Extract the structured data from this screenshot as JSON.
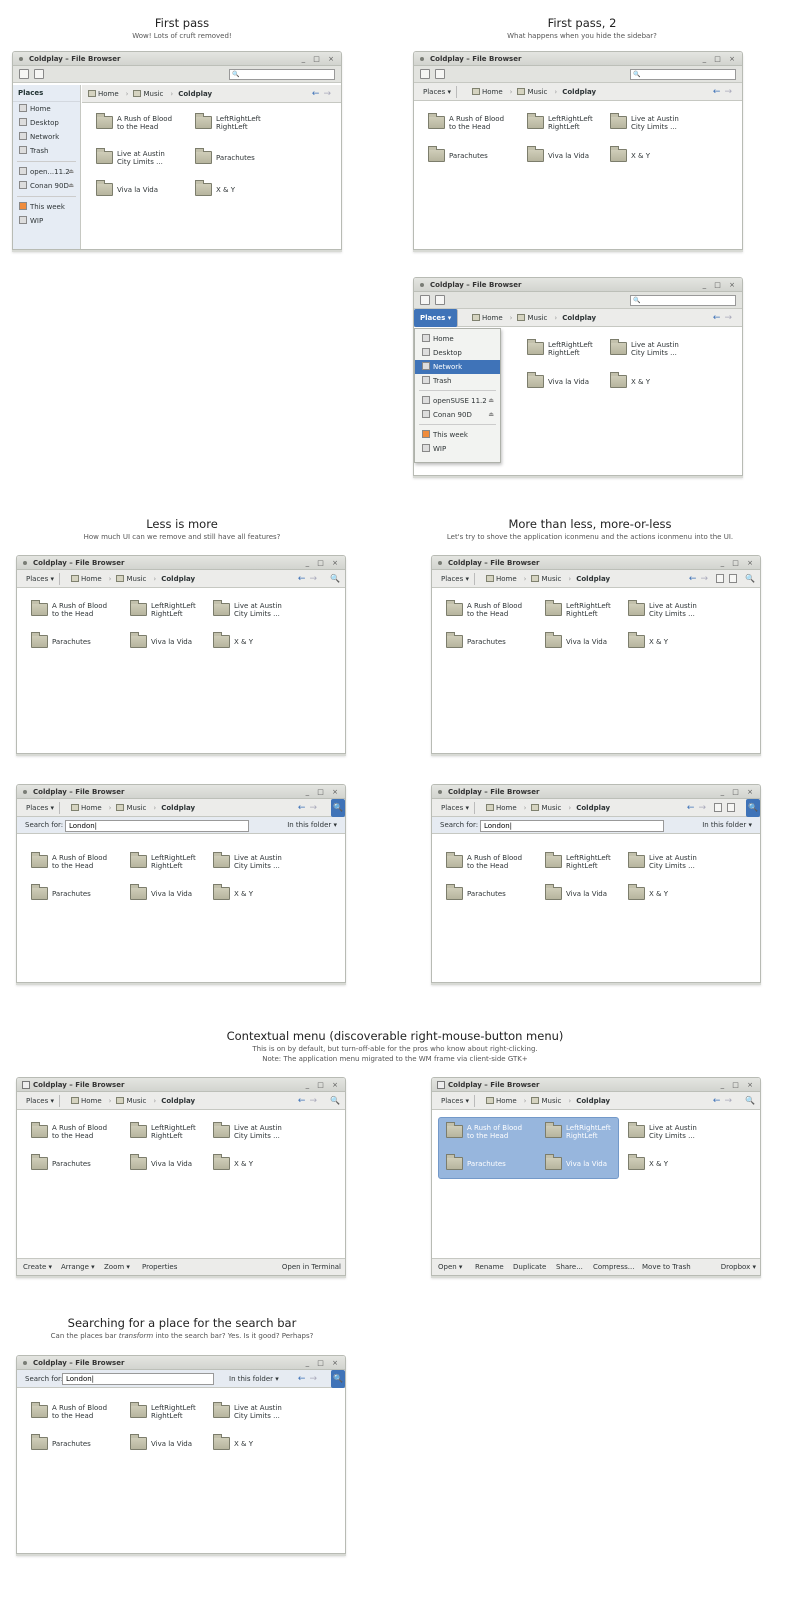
{
  "app": {
    "title": "Coldplay – File Browser",
    "controls": "_ □ ×"
  },
  "sections": {
    "first_pass": {
      "title": "First pass",
      "subtitle": "Wow! Lots of cruft removed!"
    },
    "first_pass2": {
      "title": "First pass, 2",
      "subtitle": "What happens when you hide the sidebar?"
    },
    "less": {
      "title": "Less is more",
      "subtitle": "How much UI can we remove and still have all features?"
    },
    "more": {
      "title": "More than less, more-or-less",
      "subtitle": "Let's try to shove the application iconmenu and the actions iconmenu into the UI."
    },
    "context": {
      "title": "Contextual menu (discoverable right-mouse-button menu)",
      "subtitle1": "This is on by default, but turn-off-able for the pros who know about right-clicking.",
      "subtitle2": "Note: The application menu migrated to the WM frame via client-side GTK+"
    },
    "search": {
      "title": "Searching for a place for the search bar",
      "subtitle_a": "Can the places bar ",
      "subtitle_em": "transform",
      "subtitle_b": " into the search bar? Yes. Is it good? Perhaps?"
    }
  },
  "places": {
    "label": "Places",
    "dropdown": "Places ▾"
  },
  "breadcrumb": {
    "home": "Home",
    "music": "Music",
    "current": "Coldplay"
  },
  "sidebar": {
    "items": [
      "Home",
      "Desktop",
      "Network",
      "Trash"
    ],
    "devices": [
      "open...11.2",
      "Conan 90D"
    ],
    "devices_full": [
      "openSUSE 11.2",
      "Conan 90D"
    ],
    "bookmarks": [
      "This week",
      "WIP"
    ]
  },
  "folders": {
    "f1": "A Rush of Blood\nto the Head",
    "f2": "LeftRightLeft\nRightLeft",
    "f3": "Live at Austin\nCity Limits ...",
    "f4": "Parachutes",
    "f5": "Viva la Vida",
    "f6": "X & Y"
  },
  "search": {
    "label": "Search for:",
    "value": "London|",
    "scope": "In this folder ▾",
    "glyph": "🔍"
  },
  "nav": {
    "back": "←",
    "forward": "→"
  },
  "bottom_bar1": {
    "create": "Create ▾",
    "arrange": "Arrange ▾",
    "zoom": "Zoom ▾",
    "properties": "Properties",
    "terminal": "Open in Terminal"
  },
  "bottom_bar2": {
    "open": "Open ▾",
    "rename": "Rename",
    "duplicate": "Duplicate",
    "share": "Share...",
    "compress": "Compress...",
    "trash": "Move to Trash",
    "dropbox": "Dropbox ▾"
  }
}
